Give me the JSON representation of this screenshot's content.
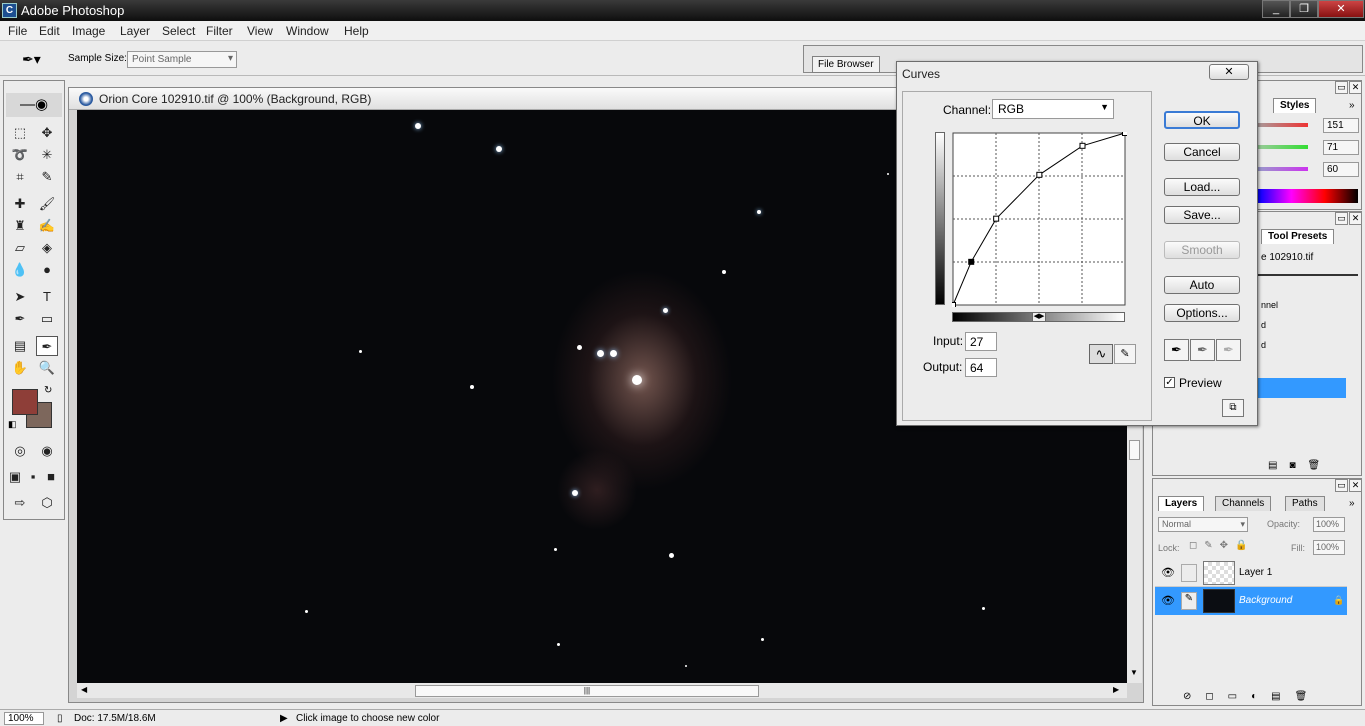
{
  "app": {
    "title": "Adobe Photoshop"
  },
  "window_controls": {
    "minimize": "_",
    "restore": "❐",
    "close": "✕"
  },
  "menu": [
    "File",
    "Edit",
    "Image",
    "Layer",
    "Select",
    "Filter",
    "View",
    "Window",
    "Help"
  ],
  "options": {
    "sample_size_label": "Sample Size:",
    "sample_size_value": "Point Sample",
    "file_browser_tab": "File Browser"
  },
  "document": {
    "title": "Orion Core 102910.tif @ 100% (Background, RGB)"
  },
  "status": {
    "zoom": "100%",
    "doc": "Doc: 17.5M/18.6M",
    "hint": "Click image to choose new color"
  },
  "curves": {
    "title": "Curves",
    "channel_label": "Channel:",
    "channel_value": "RGB",
    "input_label": "Input:",
    "input_value": "27",
    "output_label": "Output:",
    "output_value": "64",
    "buttons": {
      "ok": "OK",
      "cancel": "Cancel",
      "load": "Load...",
      "save": "Save...",
      "smooth": "Smooth",
      "auto": "Auto",
      "options": "Options..."
    },
    "preview_label": "Preview",
    "points": [
      [
        0,
        0
      ],
      [
        27,
        64
      ],
      [
        64,
        128
      ],
      [
        128,
        193
      ],
      [
        192,
        236
      ],
      [
        255,
        255
      ]
    ]
  },
  "color_panel": {
    "tab": "Styles",
    "r": "151",
    "g": "71",
    "b": "60"
  },
  "history_panel": {
    "tab": "Tool Presets",
    "items": [
      "e 102910.tif",
      "nnel",
      "d",
      "d"
    ]
  },
  "layers_panel": {
    "tabs": [
      "Layers",
      "Channels",
      "Paths"
    ],
    "blend": "Normal",
    "opacity_label": "Opacity:",
    "opacity": "100%",
    "lock_label": "Lock:",
    "fill_label": "Fill:",
    "fill": "100%",
    "layers": [
      {
        "name": "Layer 1"
      },
      {
        "name": "Background"
      }
    ]
  },
  "colors": {
    "foreground": "#8e3e38",
    "background": "#7d675c",
    "accent": "#3399ff"
  }
}
